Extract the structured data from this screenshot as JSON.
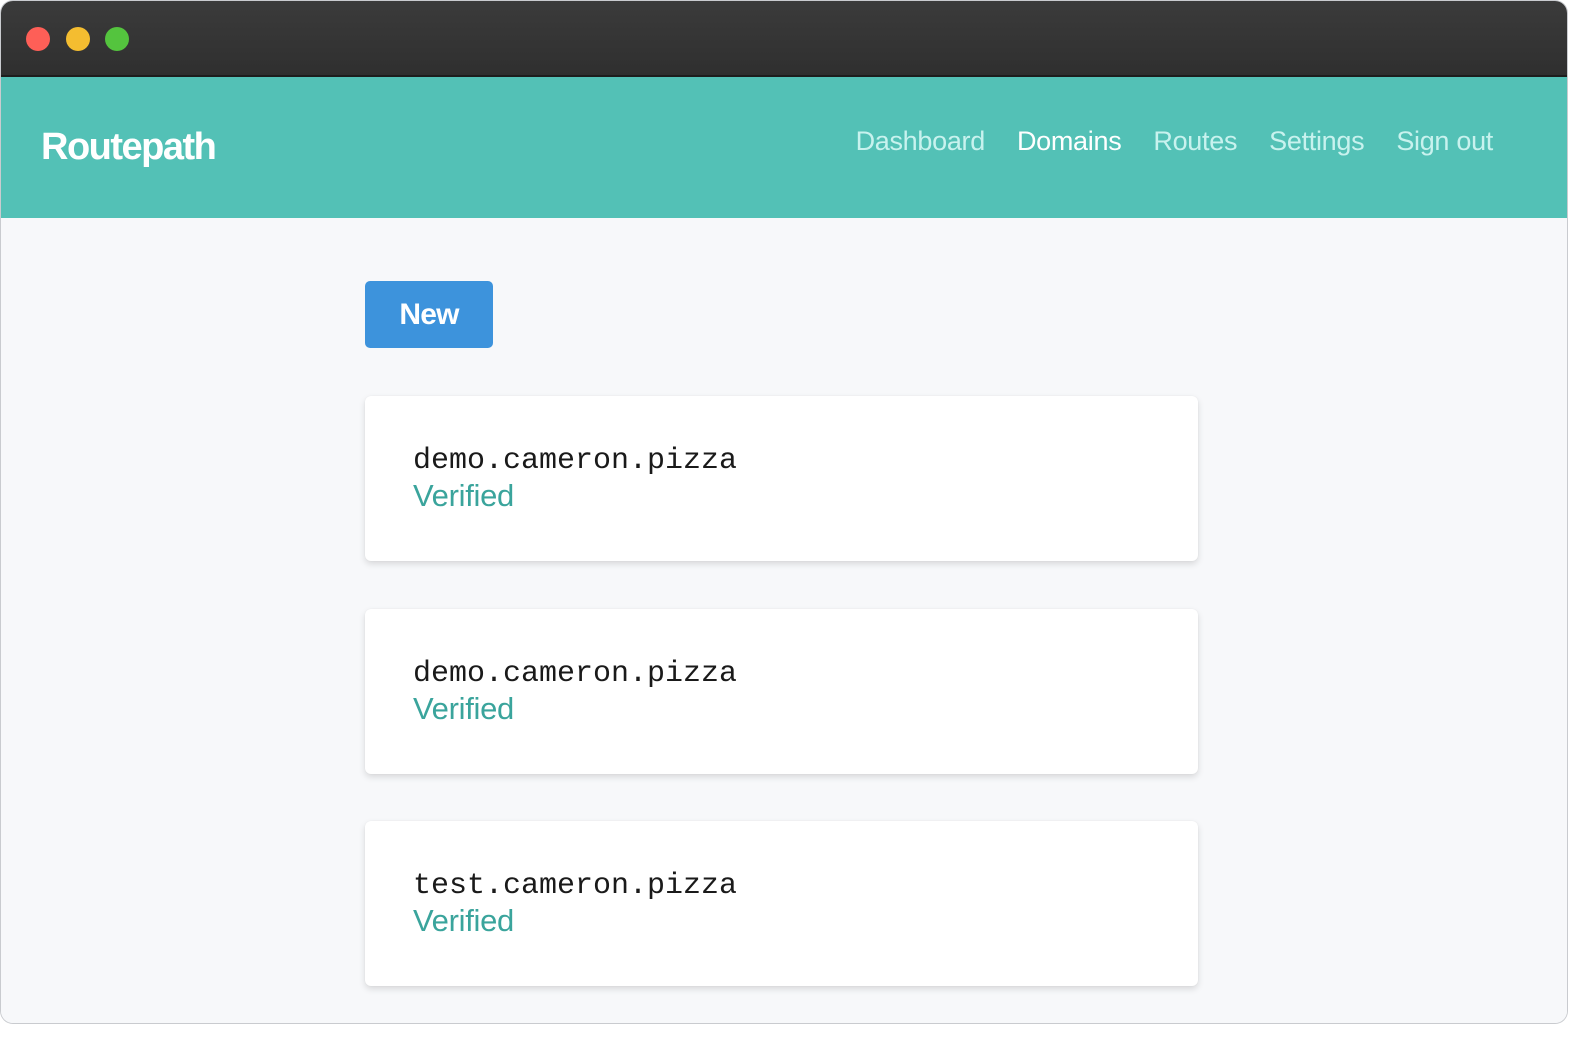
{
  "window": {
    "controls": [
      "close",
      "minimize",
      "zoom"
    ]
  },
  "navbar": {
    "brand": "Routepath",
    "links": [
      {
        "label": "Dashboard",
        "active": false
      },
      {
        "label": "Domains",
        "active": true
      },
      {
        "label": "Routes",
        "active": false
      },
      {
        "label": "Settings",
        "active": false
      },
      {
        "label": "Sign out",
        "active": false
      }
    ],
    "colors": {
      "background": "#53c1b6",
      "link": "#c8f2ee",
      "active_link": "#ffffff"
    }
  },
  "main": {
    "new_button_label": "New",
    "new_button_color": "#3d93dc",
    "domains": [
      {
        "name": "demo.cameron.pizza",
        "status": "Verified"
      },
      {
        "name": "demo.cameron.pizza",
        "status": "Verified"
      },
      {
        "name": "test.cameron.pizza",
        "status": "Verified"
      }
    ],
    "status_color": "#3aa49c"
  }
}
